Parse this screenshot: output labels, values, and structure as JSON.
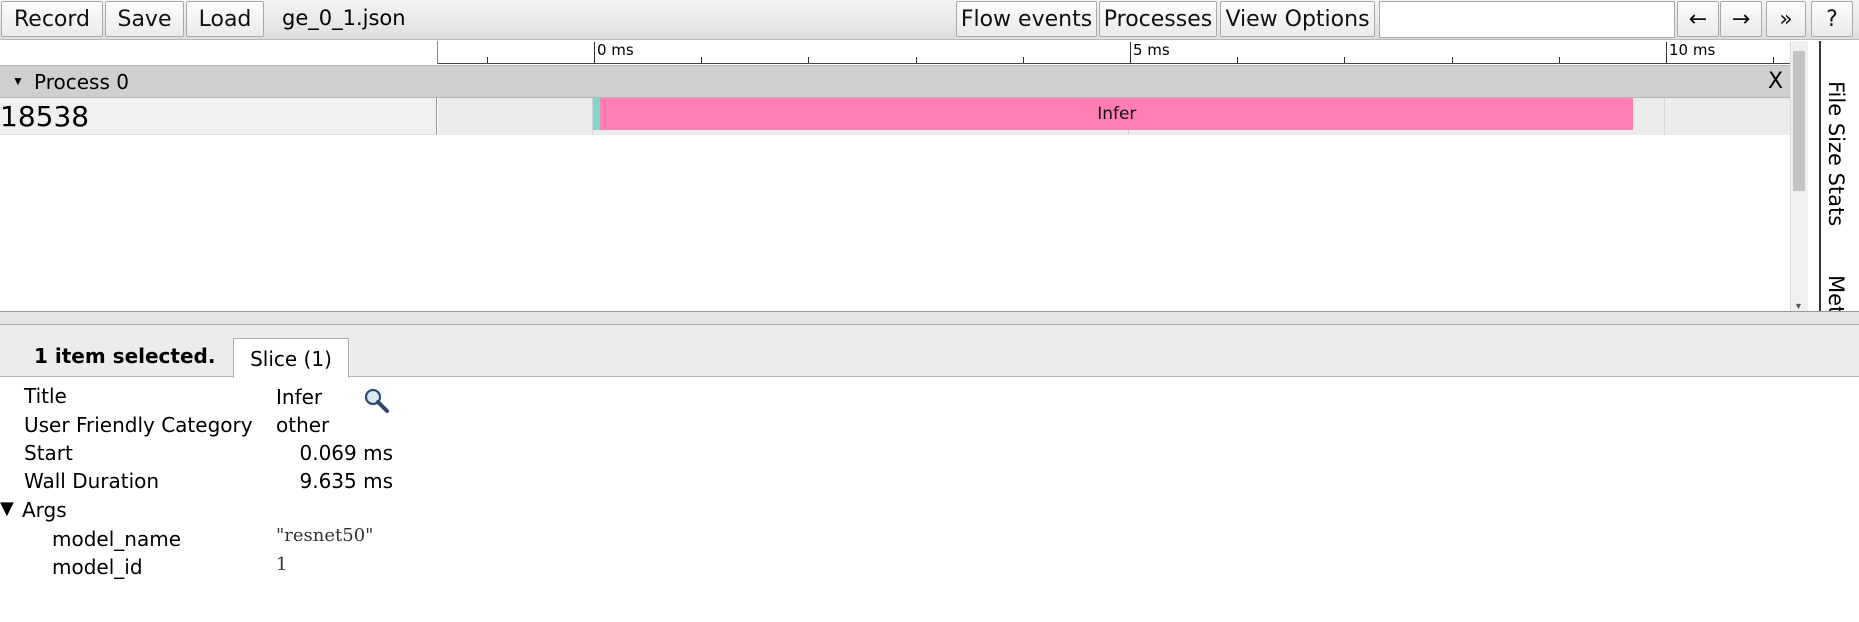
{
  "toolbar": {
    "record_label": "Record",
    "save_label": "Save",
    "load_label": "Load",
    "file_name": "ge_0_1.json",
    "flow_events_label": "Flow events",
    "processes_label": "Processes",
    "view_options_label": "View Options",
    "search_value": "",
    "prev_label": "←",
    "next_label": "→",
    "more_label": "»",
    "help_label": "?"
  },
  "timeline": {
    "ticks": [
      "0 ms",
      "5 ms",
      "10 ms"
    ],
    "process": {
      "title": "Process 0",
      "close_label": "X"
    },
    "thread": {
      "name": "18538"
    },
    "slice": {
      "title": "Infer",
      "color": "#ff7eb6",
      "start_ms": 0.069,
      "duration_ms": 9.635
    },
    "small_slice": {
      "color": "#7fd8c8"
    }
  },
  "side_panel": {
    "tabs": [
      "File Size Stats",
      "Met"
    ]
  },
  "analysis": {
    "selection_summary": "1 item selected.",
    "tab_label": "Slice (1)",
    "rows": [
      {
        "label": "Title",
        "value": "Infer"
      },
      {
        "label": "User Friendly Category",
        "value": "other"
      },
      {
        "label": "Start",
        "value": "0.069 ms"
      },
      {
        "label": "Wall Duration",
        "value": "9.635 ms"
      }
    ],
    "args": {
      "label": "Args",
      "toggle": "▼",
      "items": [
        {
          "key": "model_name",
          "value": "\"resnet50\""
        },
        {
          "key": "model_id",
          "value": "1"
        }
      ]
    }
  }
}
